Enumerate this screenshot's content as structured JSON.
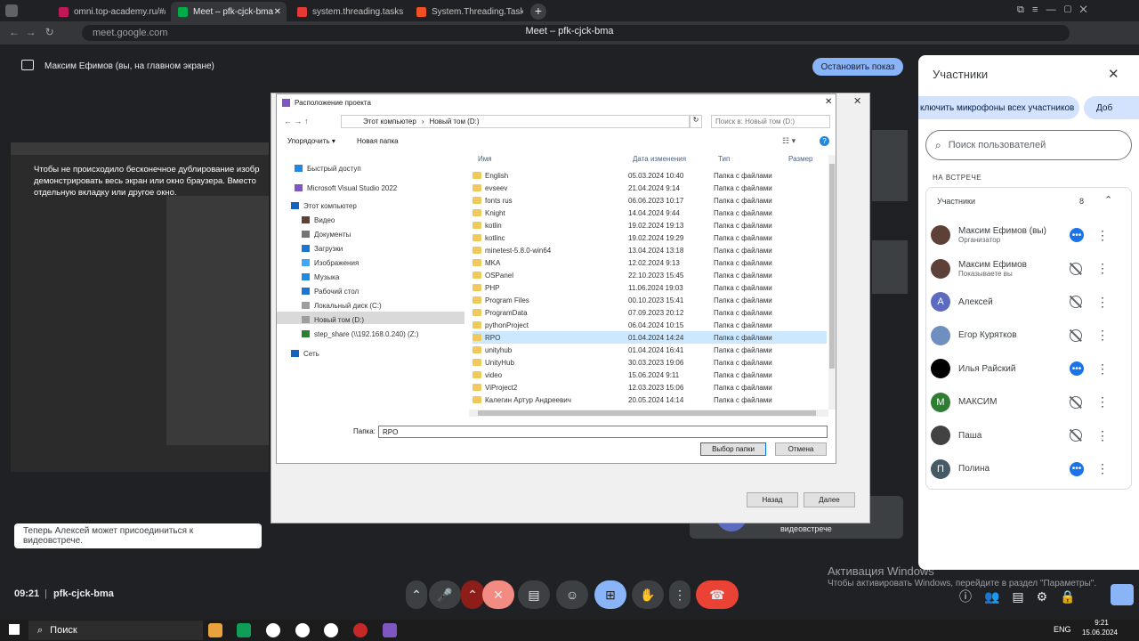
{
  "tabs": [
    "omni.top-academy.ru/#/p",
    "Meet – pfk-cjck-bma",
    "system.threading.tasks —",
    "System.Threading.Tasks П"
  ],
  "url": "meet.google.com",
  "window_title": "Meet – pfk-cjck-bma",
  "presenting_label": "Максим Ефимов (вы, на главном экране)",
  "stop_share": "Остановить показ",
  "shared_text": "Чтобы не происходило бесконечное дублирование изобр демонстрировать весь экран или окно браузера. Вместо отдельную вкладку или другое окно.",
  "dialog": {
    "outer_close": "✕",
    "title": "Расположение проекта",
    "path": [
      "Этот компьютер",
      "Новый том (D:)"
    ],
    "search_placeholder": "Поиск в: Новый том (D:)",
    "organize": "Упорядочить ▾",
    "new_folder": "Новая папка",
    "headers": [
      "Имя",
      "Дата изменения",
      "Тип",
      "Размер"
    ],
    "tree": [
      "Быстрый доступ",
      "Microsoft Visual Studio 2022",
      "Этот компьютер",
      "Видео",
      "Документы",
      "Загрузки",
      "Изображения",
      "Музыка",
      "Рабочий стол",
      "Локальный диск (C:)",
      "Новый том (D:)",
      "step_share (\\\\192.168.0.240) (Z:)",
      "Сеть"
    ],
    "files": [
      {
        "name": "English",
        "date": "05.03.2024 10:40",
        "type": "Папка с файлами"
      },
      {
        "name": "evseev",
        "date": "21.04.2024 9:14",
        "type": "Папка с файлами"
      },
      {
        "name": "fonts rus",
        "date": "06.06.2023 10:17",
        "type": "Папка с файлами"
      },
      {
        "name": "Knight",
        "date": "14.04.2024 9:44",
        "type": "Папка с файлами"
      },
      {
        "name": "kotlin",
        "date": "19.02.2024 19:13",
        "type": "Папка с файлами"
      },
      {
        "name": "kotlinc",
        "date": "19.02.2024 19:29",
        "type": "Папка с файлами"
      },
      {
        "name": "minetest-5.8.0-win64",
        "date": "13.04.2024 13:18",
        "type": "Папка с файлами"
      },
      {
        "name": "MKA",
        "date": "12.02.2024 9:13",
        "type": "Папка с файлами"
      },
      {
        "name": "OSPanel",
        "date": "22.10.2023 15:45",
        "type": "Папка с файлами"
      },
      {
        "name": "PHP",
        "date": "11.06.2024 19:03",
        "type": "Папка с файлами"
      },
      {
        "name": "Program Files",
        "date": "00.10.2023 15:41",
        "type": "Папка с файлами"
      },
      {
        "name": "ProgramData",
        "date": "07.09.2023 20:12",
        "type": "Папка с файлами"
      },
      {
        "name": "pythonProject",
        "date": "06.04.2024 10:15",
        "type": "Папка с файлами"
      },
      {
        "name": "RPO",
        "date": "01.04.2024 14:24",
        "type": "Папка с файлами"
      },
      {
        "name": "unityhub",
        "date": "01.04.2024 16:41",
        "type": "Папка с файлами"
      },
      {
        "name": "UnityHub",
        "date": "30.03.2023 19:06",
        "type": "Папка с файлами"
      },
      {
        "name": "video",
        "date": "15.06.2024 9:11",
        "type": "Папка с файлами"
      },
      {
        "name": "ViProject2",
        "date": "12.03.2023 15:06",
        "type": "Папка с файлами"
      },
      {
        "name": "Калегин Артур Андреевич",
        "date": "20.05.2024 14:14",
        "type": "Папка с файлами"
      }
    ],
    "folder_label": "Папка:",
    "folder_value": "RPO",
    "select": "Выбор папки",
    "cancel": "Отмена",
    "back": "Назад",
    "next": "Далее"
  },
  "participants": {
    "title": "Участники",
    "mute_all": "ключить микрофоны всех участников",
    "add": "Доб",
    "search_placeholder": "Поиск пользователей",
    "section": "НА ВСТРЕЧЕ",
    "group": "Участники",
    "count": "8",
    "people": [
      {
        "name": "Максим Ефимов (вы)",
        "sub": "Организатор",
        "initial": "",
        "color": "#5d4037",
        "state": "active"
      },
      {
        "name": "Максим Ефимов",
        "sub": "Показываете вы",
        "initial": "",
        "color": "#5d4037",
        "state": "muted-off"
      },
      {
        "name": "Алексей",
        "sub": "",
        "initial": "А",
        "color": "#5c6bc0",
        "state": "muted"
      },
      {
        "name": "Егор Курятков",
        "sub": "",
        "initial": "",
        "color": "#6f8fc0",
        "state": "muted"
      },
      {
        "name": "Илья Райский",
        "sub": "",
        "initial": "",
        "color": "#000000",
        "state": "active"
      },
      {
        "name": "МАКСИМ",
        "sub": "",
        "initial": "М",
        "color": "#2e7d32",
        "state": "muted"
      },
      {
        "name": "Паша",
        "sub": "",
        "initial": "",
        "color": "#424242",
        "state": "muted"
      },
      {
        "name": "Полина",
        "sub": "",
        "initial": "П",
        "color": "#455a64",
        "state": "active"
      }
    ]
  },
  "toast": "Теперь Алексей может присоединиться к видеовстрече.",
  "tile_text": "видеовстрече",
  "time": "09:21",
  "meeting_code": "pfk-cjck-bma",
  "watermark_title": "Активация Windows",
  "watermark_text": "Чтобы активировать Windows, перейдите в раздел \"Параметры\".",
  "taskbar": {
    "search": "Поиск",
    "lang": "ENG",
    "clock_time": "9:21",
    "clock_date": "15.06.2024"
  }
}
